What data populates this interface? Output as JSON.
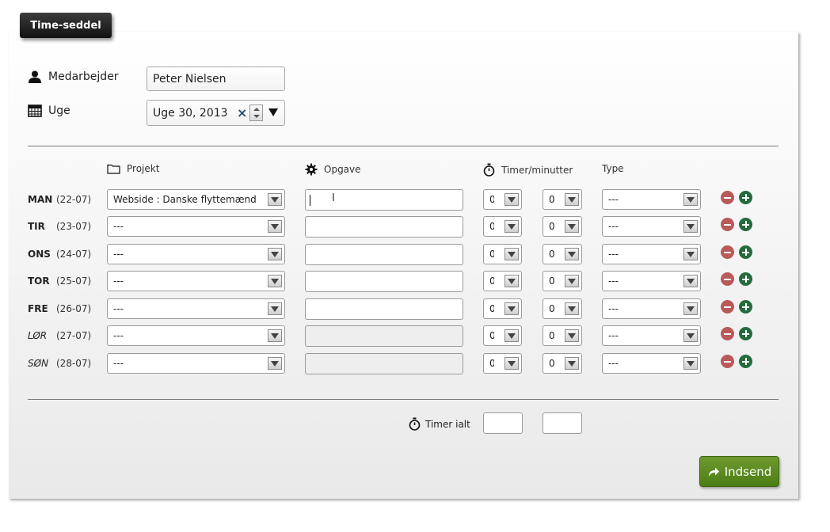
{
  "tab_title": "Time-seddel",
  "employee": {
    "label": "Medarbejder",
    "value": "Peter Nielsen",
    "icon": "person-icon"
  },
  "week": {
    "label": "Uge",
    "value": "Uge 30, 2013",
    "icon": "calendar-icon"
  },
  "columns": {
    "project": "Projekt",
    "task": "Opgave",
    "hours": "Timer/minutter",
    "type": "Type"
  },
  "rows": [
    {
      "day": "MAN",
      "date": "(22-07)",
      "project": "Webside : Danske flyttemænd I/S",
      "hours": "0",
      "minutes": "00",
      "type": "---",
      "weekend": false
    },
    {
      "day": "TIR",
      "date": "(23-07)",
      "project": "---",
      "hours": "0",
      "minutes": "00",
      "type": "---",
      "weekend": false
    },
    {
      "day": "ONS",
      "date": "(24-07)",
      "project": "---",
      "hours": "0",
      "minutes": "00",
      "type": "---",
      "weekend": false
    },
    {
      "day": "TOR",
      "date": "(25-07)",
      "project": "---",
      "hours": "0",
      "minutes": "00",
      "type": "---",
      "weekend": false
    },
    {
      "day": "FRE",
      "date": "(26-07)",
      "project": "---",
      "hours": "0",
      "minutes": "00",
      "type": "---",
      "weekend": false
    },
    {
      "day": "LØR",
      "date": "(27-07)",
      "project": "---",
      "hours": "0",
      "minutes": "00",
      "type": "---",
      "weekend": true
    },
    {
      "day": "SØN",
      "date": "(28-07)",
      "project": "---",
      "hours": "0",
      "minutes": "00",
      "type": "---",
      "weekend": true
    }
  ],
  "total": {
    "label": "Timer ialt"
  },
  "submit_label": "Indsend",
  "colors": {
    "submit": "#5a8a1e",
    "remove": "#b85a5a",
    "add": "#246b3d"
  }
}
